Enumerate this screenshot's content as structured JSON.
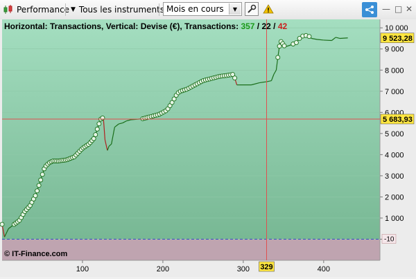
{
  "toolbar": {
    "performance_label": "Performance",
    "instruments_label": "Tous les instruments",
    "period_value": "Mois en cours"
  },
  "chart": {
    "header_prefix": "Horizontal: Transactions, Vertical: Devise (€), Transactions: ",
    "count_total": "357",
    "count_sep1": " / ",
    "count_flat": "22",
    "count_sep2": " / ",
    "count_losing": "42",
    "watermark": "© IT-Finance.com",
    "last_value_label": "9 523,28",
    "crosshair_y_label": "5 683,93",
    "crosshair_x_label": "329",
    "zero_line_label": "-10",
    "colors": {
      "line": "#1a6e1a",
      "down": "#b02020",
      "marker_fill": "#e6f5e6",
      "count_green": "#1a9a1a",
      "count_red": "#cc2020",
      "crosshair": "#e05050",
      "label_bg": "#ffe640"
    }
  },
  "chart_data": {
    "type": "line",
    "xlabel": "",
    "ylabel": "",
    "xlim": [
      0,
      470
    ],
    "ylim": [
      -1000,
      10400
    ],
    "x_ticks": [
      "100",
      "200",
      "300",
      "400"
    ],
    "x_tick_values": [
      100,
      200,
      300,
      400
    ],
    "y_ticks": [
      "10 000",
      "9 000",
      "8 000",
      "7 000",
      "6 000",
      "5 000",
      "4 000",
      "3 000",
      "2 000",
      "1 000",
      "0"
    ],
    "y_tick_values": [
      10000,
      9000,
      8000,
      7000,
      6000,
      5000,
      4000,
      3000,
      2000,
      1000,
      0
    ],
    "x": [
      0,
      3,
      8,
      15,
      22,
      28,
      35,
      42,
      48,
      53,
      58,
      63,
      70,
      80,
      90,
      100,
      108,
      115,
      120,
      123,
      126,
      128,
      131,
      133,
      136,
      140,
      145,
      150,
      155,
      160,
      175,
      185,
      195,
      205,
      212,
      218,
      222,
      226,
      230,
      240,
      250,
      260,
      270,
      280,
      288,
      292,
      295,
      310,
      320,
      329,
      335,
      338,
      341,
      343,
      346,
      352,
      360,
      366,
      372,
      380,
      385,
      392,
      400,
      410,
      415,
      420,
      430
    ],
    "y": [
      700,
      100,
      500,
      700,
      900,
      1300,
      1600,
      2100,
      2800,
      3400,
      3600,
      3700,
      3700,
      3750,
      3900,
      4300,
      4500,
      4800,
      5400,
      5700,
      5750,
      4700,
      4200,
      4400,
      4500,
      5300,
      5450,
      5500,
      5600,
      5650,
      5700,
      5800,
      5900,
      6100,
      6500,
      6900,
      7000,
      7050,
      7100,
      7300,
      7500,
      7600,
      7700,
      7750,
      7800,
      7300,
      7300,
      7300,
      7400,
      7450,
      7500,
      7800,
      8000,
      8600,
      9400,
      9100,
      9200,
      9300,
      9600,
      9650,
      9500,
      9450,
      9420,
      9400,
      9550,
      9500,
      9523
    ]
  }
}
